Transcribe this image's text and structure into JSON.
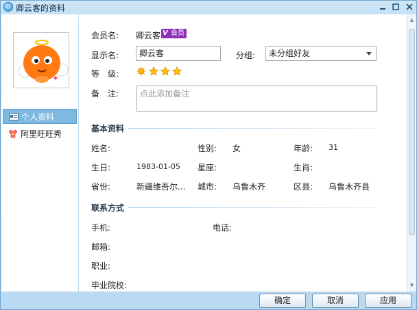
{
  "window": {
    "title": "卿云客的资料"
  },
  "nav": {
    "items": [
      {
        "label": "个人资料",
        "active": true
      },
      {
        "label": "阿里旺旺秀",
        "active": false
      }
    ]
  },
  "profile": {
    "member_name_label": "会员名:",
    "member_name": "卿云客",
    "member_badge": "会员",
    "display_name_label": "显示名:",
    "display_name": "卿云客",
    "group_label": "分组:",
    "group_value": "未分组好友",
    "level_label": "等　级:",
    "level_icons": [
      "sun-icon",
      "star-icon",
      "star-icon",
      "star-icon"
    ],
    "note_label": "备　注:",
    "note_placeholder": "点此添加备注"
  },
  "basic_info": {
    "title": "基本资料",
    "name_label": "姓名:",
    "name_value": "",
    "gender_label": "性别:",
    "gender_value": "女",
    "age_label": "年龄:",
    "age_value": "31",
    "birthday_label": "生日:",
    "birthday_value": "1983-01-05",
    "zodiac_label": "星座:",
    "zodiac_value": "",
    "animal_label": "生肖:",
    "animal_value": "",
    "province_label": "省份:",
    "province_value": "新疆维吾尔...",
    "city_label": "城市:",
    "city_value": "乌鲁木齐",
    "district_label": "区县:",
    "district_value": "乌鲁木齐县"
  },
  "contact": {
    "title": "联系方式",
    "mobile_label": "手机:",
    "phone_label": "电话:",
    "email_label": "邮箱:",
    "job_label": "职业:",
    "school_label": "毕业院校:"
  },
  "buttons": {
    "ok": "确定",
    "cancel": "取消",
    "apply": "应用"
  },
  "colors": {
    "titlebar": "#bcdcf2",
    "nav_active": "#7fb9e0",
    "badge": "#8c2fb8"
  }
}
